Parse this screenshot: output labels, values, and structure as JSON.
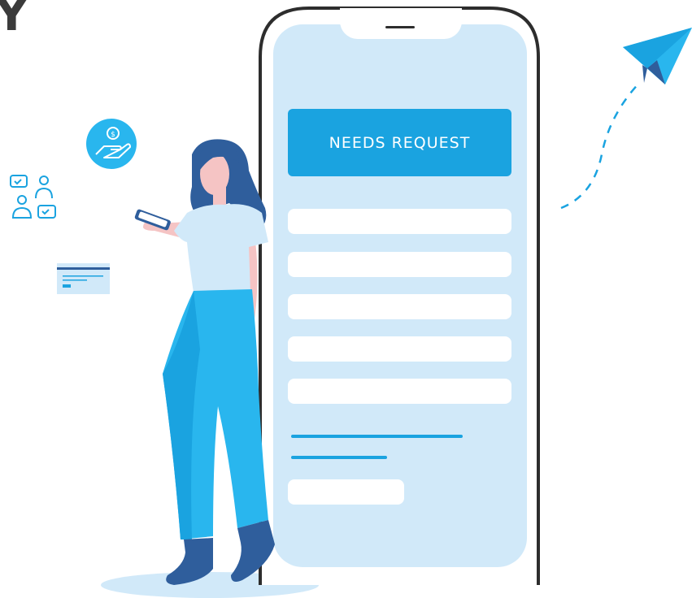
{
  "form": {
    "header_label": "NEEDS REQUEST",
    "field_count": 5
  },
  "decor": {
    "partial_heading_glyph": "Y",
    "icons": [
      "dollar-hand-icon",
      "team-chat-icon",
      "credit-card-icon",
      "paper-plane-icon"
    ]
  },
  "colors": {
    "brand_blue": "#1aa3e0",
    "light_blue": "#d1e9f9",
    "dark_blue": "#2f5e9c",
    "skin": "#f5c4c4",
    "outline": "#2d2d2d"
  }
}
